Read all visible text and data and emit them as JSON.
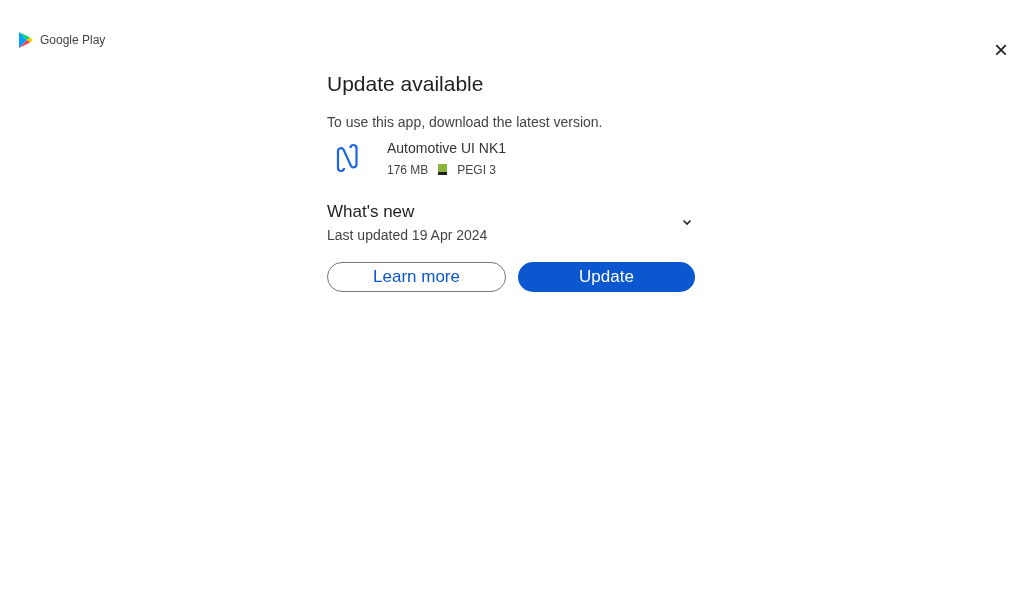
{
  "header": {
    "brand": "Google Play",
    "close": "×"
  },
  "dialog": {
    "title": "Update available",
    "message": "To use this app, download the latest version.",
    "app": {
      "name": "Automotive UI NK1",
      "size": "176 MB",
      "rating": "PEGI 3"
    },
    "whats_new": {
      "title": "What's new",
      "subtitle": "Last updated 19 Apr 2024",
      "expanded": false
    },
    "buttons": [
      {
        "label": "Learn more",
        "kind": "outline"
      },
      {
        "label": "Update",
        "kind": "filled"
      }
    ]
  }
}
